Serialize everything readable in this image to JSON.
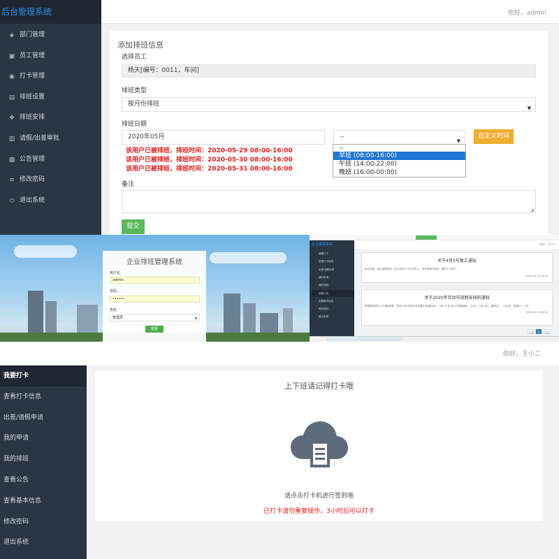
{
  "admin_panel": {
    "brand": "后台管理系统",
    "greeting": "你好，admin",
    "nav": [
      {
        "icon": "cube-icon",
        "glyph": "◈",
        "label": "部门管理"
      },
      {
        "icon": "id-card-icon",
        "glyph": "▣",
        "label": "员工管理"
      },
      {
        "icon": "camera-icon",
        "glyph": "◉",
        "label": "打卡管理"
      },
      {
        "icon": "save-icon",
        "glyph": "▤",
        "label": "排班设置"
      },
      {
        "icon": "cubes-icon",
        "glyph": "❖",
        "label": "排班安排"
      },
      {
        "icon": "image-icon",
        "glyph": "▥",
        "label": "请假/出差审批"
      },
      {
        "icon": "book-icon",
        "glyph": "▦",
        "label": "公告管理"
      },
      {
        "icon": "sliders-icon",
        "glyph": "≡",
        "label": "修改密码"
      },
      {
        "icon": "power-icon",
        "glyph": "⏻",
        "label": "退出系统"
      }
    ],
    "form": {
      "title": "添加排班信息",
      "employee_label": "选择员工",
      "employee_value": "杨天[编号：0011，车间]",
      "type_label": "排班类型",
      "type_value": "按月份排班",
      "date_label": "排班日期",
      "month_value": "2020年05月",
      "shift_select_value": "--",
      "custom_time_button": "自定义时间",
      "warnings": [
        "该用户已被排班，排班时间：2020-05-29 08:00-16:00",
        "该用户已被排班，排班时间：2020-05-30 08:00-16:00",
        "该用户已被排班，排班时间：2020-05-31 08:00-16:00"
      ],
      "shift_options": [
        "--",
        "早班 (08:00-16:00)",
        "午班 (14:00-22:00)",
        "晚班 (16:00-00:00)"
      ],
      "shift_selected": "早班 (08:00-16:00)",
      "remark_label": "备注",
      "submit_button": "提交"
    }
  },
  "login_panel": {
    "title": "企业排班管理系统",
    "username_label": "用户名：",
    "username_value": "admin",
    "password_label": "密码：",
    "password_value": "••••••",
    "role_label": "角色：",
    "role_value": "管理员",
    "login_button": "登录"
  },
  "announcement_panel": {
    "brand": "企业排班系统",
    "greeting": "你好，王小二",
    "nav": [
      "我要打卡",
      "查看打卡信息",
      "出差/请假申请",
      "我的申请",
      "我的排班",
      "查看公告",
      "查看基本信息",
      "修改密码",
      "退出系统"
    ],
    "active_index": 5,
    "notices": [
      {
        "title": "关于4月5号复工通知",
        "body": "各位同事，因为疫情原因，本公司将于4月5号复工，请大家准时到岗，做好个人防护。",
        "date": "2020-04-15 09:33"
      },
      {
        "title": "关于2020年劳动节放假安排的通知",
        "body": "根据国务院办公厅通知精神，现将2020年劳动节放假安排通知如下：5月1日至5月5日放假调休，共5天。4月26日（星期日）、5月9日（星期六）上班。",
        "date": "2020-04-20 09:34"
      }
    ],
    "pager": [
      "上页",
      "1",
      "下页"
    ]
  },
  "employee_panel": {
    "greeting": "你好，王小二",
    "nav": [
      "我要打卡",
      "查看打卡信息",
      "出差/请假申请",
      "我的申请",
      "我的排班",
      "查看公告",
      "查看基本信息",
      "修改密码",
      "退出系统"
    ],
    "active_index": 0,
    "title": "上下班请记得打卡哦",
    "hint": "请点击打卡机进行签到哦",
    "alert": "已打卡请勿重复操作，3小时后可以打卡"
  },
  "colors": {
    "sidebar": "#2b3644",
    "brand_blue": "#2b8be6",
    "warning_red": "#e21c1c",
    "submit_green": "#5cb85c",
    "custom_orange": "#f0ad2e",
    "clock_icon": "#5d6b7a"
  }
}
